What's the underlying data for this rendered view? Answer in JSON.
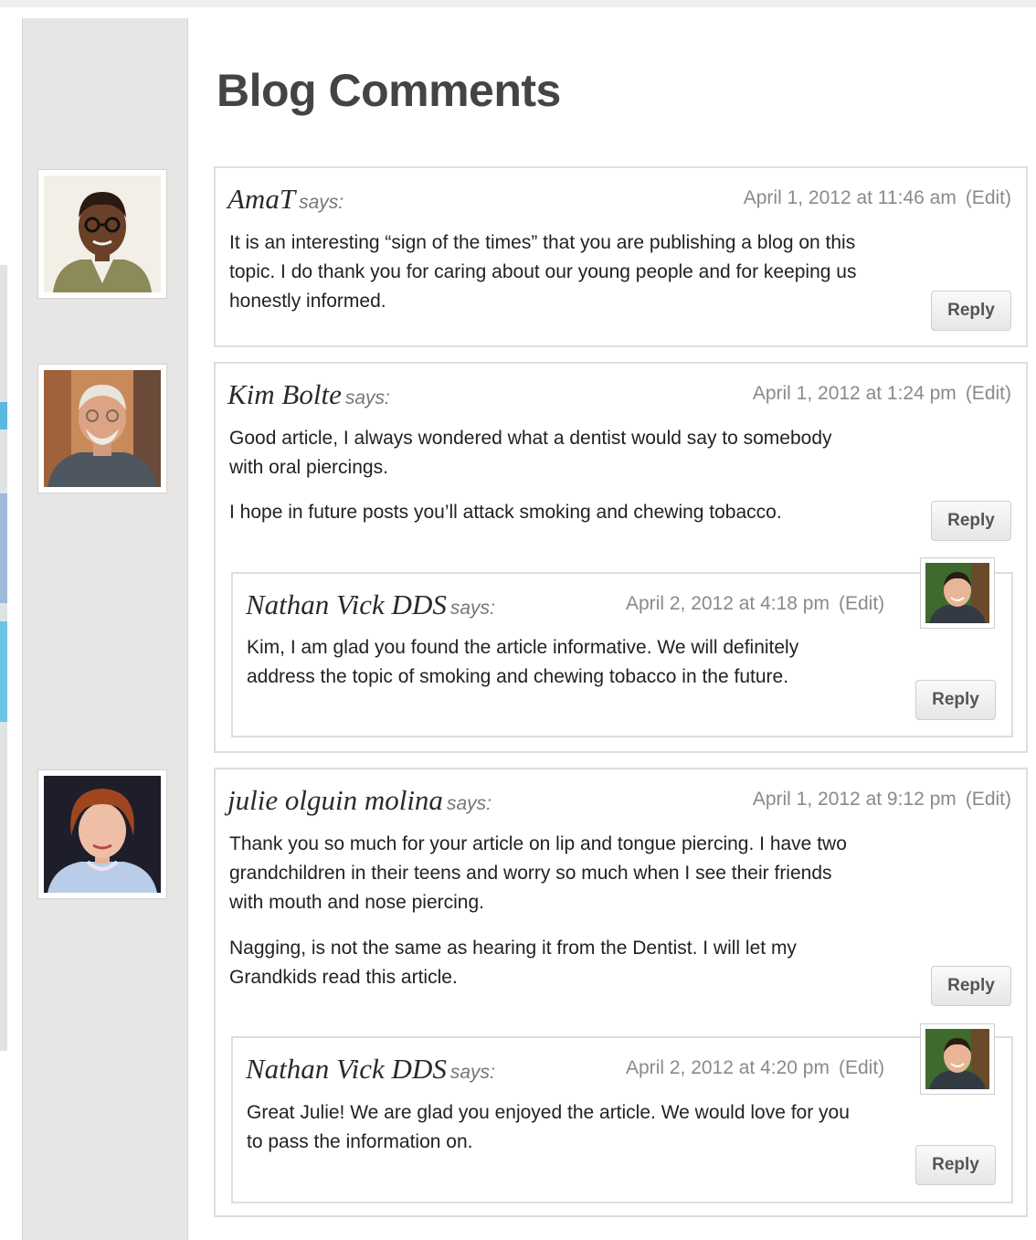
{
  "page": {
    "title": "Blog Comments"
  },
  "comments": [
    {
      "author": "AmaT",
      "says": "says:",
      "date": "April 1, 2012 at 11:46 am",
      "edit": "(Edit)",
      "paragraphs": [
        [
          "It is an interesting “sign of the times” that you are publishing a blog on this",
          "topic. I do thank you for caring about our young people and for keeping us",
          "honestly informed."
        ]
      ],
      "reply": "Reply"
    },
    {
      "author": "Kim Bolte",
      "says": "says:",
      "date": "April 1, 2012 at 1:24 pm",
      "edit": "(Edit)",
      "paragraphs": [
        [
          "Good article, I always wondered what a dentist would say to somebody",
          "with oral piercings."
        ],
        [
          "I hope in future posts you’ll attack smoking and chewing tobacco."
        ]
      ],
      "reply": "Reply",
      "replies": [
        {
          "author": "Nathan Vick DDS",
          "says": "says:",
          "date": "April 2, 2012 at 4:18 pm",
          "edit": "(Edit)",
          "paragraphs": [
            [
              "Kim, I am glad you found the article informative. We will definitely",
              "address the topic of smoking and chewing tobacco in the future."
            ]
          ],
          "reply": "Reply"
        }
      ]
    },
    {
      "author": "julie olguin molina",
      "says": "says:",
      "date": "April 1, 2012 at 9:12 pm",
      "edit": "(Edit)",
      "paragraphs": [
        [
          "Thank you so much for your article on lip and tongue piercing. I have two",
          "grandchildren in their teens and worry so much when I see their friends",
          "with mouth and nose piercing."
        ],
        [
          "Nagging, is not the same as hearing it from the Dentist. I will let my",
          "Grandkids read this article."
        ]
      ],
      "reply": "Reply",
      "replies": [
        {
          "author": "Nathan Vick DDS",
          "says": "says:",
          "date": "April 2, 2012 at 4:20 pm",
          "edit": "(Edit)",
          "paragraphs": [
            [
              "Great Julie! We are glad you enjoyed the article. We would love for you",
              "to pass the information on."
            ]
          ],
          "reply": "Reply"
        }
      ]
    }
  ]
}
